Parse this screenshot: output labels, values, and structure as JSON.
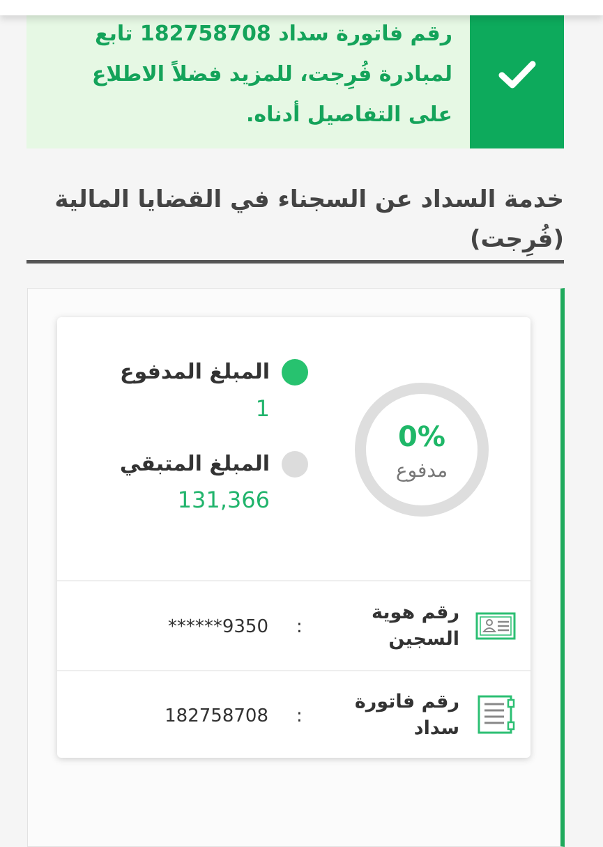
{
  "alert": {
    "message_lines": [
      "رقم فاتورة سداد 182758708 تابع",
      "لمبادرة فُرِجت، للمزيد فضلاً الاطلاع",
      "على التفاصيل أدناه."
    ],
    "icon": "check-icon",
    "colors": {
      "background": "#e6f8e4",
      "accent": "#0daa5c"
    }
  },
  "section": {
    "title_lines": [
      "خدمة السداد عن السجناء في القضايا المالية",
      "(فُرِجت)"
    ]
  },
  "summary": {
    "progress_percent_label": "0%",
    "progress_fraction": 0.0,
    "progress_caption": "مدفوع",
    "paid": {
      "label": "المبلغ المدفوع",
      "value": "1",
      "color": "#27c26f"
    },
    "remaining": {
      "label": "المبلغ المتبقي",
      "value": "131,366",
      "color": "#dcdcdc"
    }
  },
  "details": [
    {
      "icon": "id-card-icon",
      "label_lines": [
        "رقم هوية",
        "السجين"
      ],
      "value": "******9350"
    },
    {
      "icon": "invoice-icon",
      "label_lines": [
        "رقم فاتورة",
        "سداد"
      ],
      "value": "182758708"
    }
  ],
  "separator": ":"
}
